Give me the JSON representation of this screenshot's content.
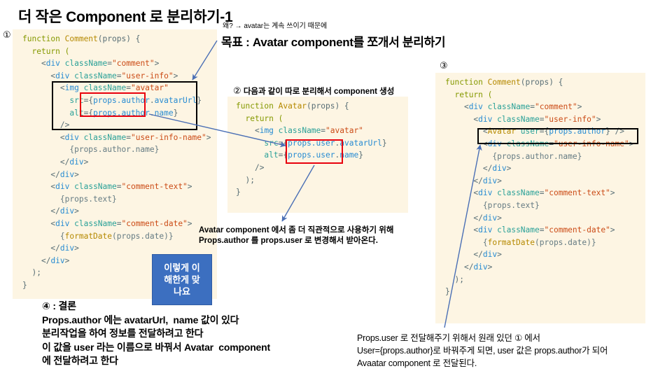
{
  "slide": {
    "title": "더 작은 Component 로 분리하기-1"
  },
  "markers": {
    "one": "①",
    "two": "②",
    "three": "③",
    "four": "④"
  },
  "notes": {
    "why": "왜? → avatar는 계속 쓰이기 때문에",
    "goal": "목표 : Avatar component를 쪼개서 분리하기",
    "step2_caption_num": "②",
    "step2_caption_text": "  다음과 같이 따로 분리해서 component 생성",
    "mid_note": "Avatar component 에서 좀 더 직관적으로 사용하기 위해\nProps.author 를 props.user 로 변경해서 받아온다.",
    "conclusion": "④ : 결론\nProps.author 에는 avatarUrl,  name 값이 있다\n분리작업을 하여 정보를 전달하려고 한다\n이 값을 user 라는 이름으로 바꿔서 Avatar  component\n에 전달하려고 한다",
    "bottom_right": "Props.user 로 전달해주기 위해서 원래 있던 ① 에서\nUser={props.author}로 바꿔주게 되면, user 값은 props.author가 되어\nAvaatar component 로 전달된다."
  },
  "callout": {
    "blue_text": "이렇게 이\n해한게 맞\n나요"
  },
  "code_blocks": {
    "block1": [
      {
        "indent": 0,
        "parts": [
          {
            "t": "function ",
            "c": "tok-kw"
          },
          {
            "t": "Comment",
            "c": "tok-fn"
          },
          {
            "t": "(props) {",
            "c": "tok-brk"
          }
        ]
      },
      {
        "indent": 1,
        "parts": [
          {
            "t": "return (",
            "c": "tok-kw"
          }
        ]
      },
      {
        "indent": 2,
        "parts": [
          {
            "t": "<",
            "c": "tok-brk"
          },
          {
            "t": "div ",
            "c": "tok-tag"
          },
          {
            "t": "className",
            "c": "tok-attr"
          },
          {
            "t": "=",
            "c": "tok-brk"
          },
          {
            "t": "\"comment\"",
            "c": "tok-str"
          },
          {
            "t": ">",
            "c": "tok-brk"
          }
        ]
      },
      {
        "indent": 3,
        "parts": [
          {
            "t": "<",
            "c": "tok-brk"
          },
          {
            "t": "div ",
            "c": "tok-tag"
          },
          {
            "t": "className",
            "c": "tok-attr"
          },
          {
            "t": "=",
            "c": "tok-brk"
          },
          {
            "t": "\"user-info\"",
            "c": "tok-str"
          },
          {
            "t": ">",
            "c": "tok-brk"
          }
        ]
      },
      {
        "indent": 4,
        "parts": [
          {
            "t": "<",
            "c": "tok-brk"
          },
          {
            "t": "img ",
            "c": "tok-tag"
          },
          {
            "t": "className",
            "c": "tok-attr"
          },
          {
            "t": "=",
            "c": "tok-brk"
          },
          {
            "t": "\"avatar\"",
            "c": "tok-str"
          }
        ]
      },
      {
        "indent": 5,
        "parts": [
          {
            "t": "src",
            "c": "tok-attr"
          },
          {
            "t": "={",
            "c": "tok-brk"
          },
          {
            "t": "props.author",
            "c": "tok-expr"
          },
          {
            "t": ".",
            "c": "tok-brk"
          },
          {
            "t": "avatarUrl",
            "c": "tok-expr"
          },
          {
            "t": "}",
            "c": "tok-brk"
          }
        ]
      },
      {
        "indent": 5,
        "parts": [
          {
            "t": "alt",
            "c": "tok-attr"
          },
          {
            "t": "={",
            "c": "tok-brk"
          },
          {
            "t": "props.author",
            "c": "tok-expr"
          },
          {
            "t": ".",
            "c": "tok-brk"
          },
          {
            "t": "name",
            "c": "tok-expr"
          },
          {
            "t": "}",
            "c": "tok-brk"
          }
        ]
      },
      {
        "indent": 4,
        "parts": [
          {
            "t": "/>",
            "c": "tok-brk"
          }
        ]
      },
      {
        "indent": 4,
        "parts": [
          {
            "t": "<",
            "c": "tok-brk"
          },
          {
            "t": "div ",
            "c": "tok-tag"
          },
          {
            "t": "className",
            "c": "tok-attr"
          },
          {
            "t": "=",
            "c": "tok-brk"
          },
          {
            "t": "\"user-info-name\"",
            "c": "tok-str"
          },
          {
            "t": ">",
            "c": "tok-brk"
          }
        ]
      },
      {
        "indent": 5,
        "parts": [
          {
            "t": "{props.author.name}",
            "c": "tok-pl"
          }
        ]
      },
      {
        "indent": 4,
        "parts": [
          {
            "t": "</",
            "c": "tok-brk"
          },
          {
            "t": "div",
            "c": "tok-tag"
          },
          {
            "t": ">",
            "c": "tok-brk"
          }
        ]
      },
      {
        "indent": 3,
        "parts": [
          {
            "t": "</",
            "c": "tok-brk"
          },
          {
            "t": "div",
            "c": "tok-tag"
          },
          {
            "t": ">",
            "c": "tok-brk"
          }
        ]
      },
      {
        "indent": 3,
        "parts": [
          {
            "t": "<",
            "c": "tok-brk"
          },
          {
            "t": "div ",
            "c": "tok-tag"
          },
          {
            "t": "className",
            "c": "tok-attr"
          },
          {
            "t": "=",
            "c": "tok-brk"
          },
          {
            "t": "\"comment-text\"",
            "c": "tok-str"
          },
          {
            "t": ">",
            "c": "tok-brk"
          }
        ]
      },
      {
        "indent": 4,
        "parts": [
          {
            "t": "{props.text}",
            "c": "tok-pl"
          }
        ]
      },
      {
        "indent": 3,
        "parts": [
          {
            "t": "</",
            "c": "tok-brk"
          },
          {
            "t": "div",
            "c": "tok-tag"
          },
          {
            "t": ">",
            "c": "tok-brk"
          }
        ]
      },
      {
        "indent": 3,
        "parts": [
          {
            "t": "<",
            "c": "tok-brk"
          },
          {
            "t": "div ",
            "c": "tok-tag"
          },
          {
            "t": "className",
            "c": "tok-attr"
          },
          {
            "t": "=",
            "c": "tok-brk"
          },
          {
            "t": "\"comment-date\"",
            "c": "tok-str"
          },
          {
            "t": ">",
            "c": "tok-brk"
          }
        ]
      },
      {
        "indent": 4,
        "parts": [
          {
            "t": "{",
            "c": "tok-pl"
          },
          {
            "t": "formatDate",
            "c": "tok-fn"
          },
          {
            "t": "(props.date)}",
            "c": "tok-pl"
          }
        ]
      },
      {
        "indent": 3,
        "parts": [
          {
            "t": "</",
            "c": "tok-brk"
          },
          {
            "t": "div",
            "c": "tok-tag"
          },
          {
            "t": ">",
            "c": "tok-brk"
          }
        ]
      },
      {
        "indent": 2,
        "parts": [
          {
            "t": "</",
            "c": "tok-brk"
          },
          {
            "t": "div",
            "c": "tok-tag"
          },
          {
            "t": ">",
            "c": "tok-brk"
          }
        ]
      },
      {
        "indent": 1,
        "parts": [
          {
            "t": ");",
            "c": "tok-brk"
          }
        ]
      },
      {
        "indent": 0,
        "parts": [
          {
            "t": "}",
            "c": "tok-brk"
          }
        ]
      }
    ],
    "block2": [
      {
        "indent": 0,
        "parts": [
          {
            "t": "function ",
            "c": "tok-kw"
          },
          {
            "t": "Avatar",
            "c": "tok-fn"
          },
          {
            "t": "(props) {",
            "c": "tok-brk"
          }
        ]
      },
      {
        "indent": 1,
        "parts": [
          {
            "t": "return (",
            "c": "tok-kw"
          }
        ]
      },
      {
        "indent": 2,
        "parts": [
          {
            "t": "<",
            "c": "tok-brk"
          },
          {
            "t": "img ",
            "c": "tok-tag"
          },
          {
            "t": "className",
            "c": "tok-attr"
          },
          {
            "t": "=",
            "c": "tok-brk"
          },
          {
            "t": "\"avatar\"",
            "c": "tok-str"
          }
        ]
      },
      {
        "indent": 3,
        "parts": [
          {
            "t": "src",
            "c": "tok-attr"
          },
          {
            "t": "={",
            "c": "tok-brk"
          },
          {
            "t": "props.user",
            "c": "tok-expr"
          },
          {
            "t": ".",
            "c": "tok-brk"
          },
          {
            "t": "avatarUrl",
            "c": "tok-expr"
          },
          {
            "t": "}",
            "c": "tok-brk"
          }
        ]
      },
      {
        "indent": 3,
        "parts": [
          {
            "t": "alt",
            "c": "tok-attr"
          },
          {
            "t": "={",
            "c": "tok-brk"
          },
          {
            "t": "props.user",
            "c": "tok-expr"
          },
          {
            "t": ".",
            "c": "tok-brk"
          },
          {
            "t": "name",
            "c": "tok-expr"
          },
          {
            "t": "}",
            "c": "tok-brk"
          }
        ]
      },
      {
        "indent": 2,
        "parts": [
          {
            "t": "/>",
            "c": "tok-brk"
          }
        ]
      },
      {
        "indent": 1,
        "parts": [
          {
            "t": ");",
            "c": "tok-brk"
          }
        ]
      },
      {
        "indent": 0,
        "parts": [
          {
            "t": "}",
            "c": "tok-brk"
          }
        ]
      }
    ],
    "block3": [
      {
        "indent": 0,
        "parts": [
          {
            "t": "function ",
            "c": "tok-kw"
          },
          {
            "t": "Comment",
            "c": "tok-fn"
          },
          {
            "t": "(props) {",
            "c": "tok-brk"
          }
        ]
      },
      {
        "indent": 1,
        "parts": [
          {
            "t": "return (",
            "c": "tok-kw"
          }
        ]
      },
      {
        "indent": 2,
        "parts": [
          {
            "t": "<",
            "c": "tok-brk"
          },
          {
            "t": "div ",
            "c": "tok-tag"
          },
          {
            "t": "className",
            "c": "tok-attr"
          },
          {
            "t": "=",
            "c": "tok-brk"
          },
          {
            "t": "\"comment\"",
            "c": "tok-str"
          },
          {
            "t": ">",
            "c": "tok-brk"
          }
        ]
      },
      {
        "indent": 3,
        "parts": [
          {
            "t": "<",
            "c": "tok-brk"
          },
          {
            "t": "div ",
            "c": "tok-tag"
          },
          {
            "t": "className",
            "c": "tok-attr"
          },
          {
            "t": "=",
            "c": "tok-brk"
          },
          {
            "t": "\"user-info\"",
            "c": "tok-str"
          },
          {
            "t": ">",
            "c": "tok-brk"
          }
        ]
      },
      {
        "indent": 4,
        "parts": [
          {
            "t": "<",
            "c": "tok-brk"
          },
          {
            "t": "Avatar ",
            "c": "tok-fn"
          },
          {
            "t": "user",
            "c": "tok-attr"
          },
          {
            "t": "={",
            "c": "tok-brk"
          },
          {
            "t": "props.author",
            "c": "tok-expr"
          },
          {
            "t": "} />",
            "c": "tok-brk"
          }
        ]
      },
      {
        "indent": 4,
        "parts": [
          {
            "t": "<",
            "c": "tok-brk"
          },
          {
            "t": "div ",
            "c": "tok-tag"
          },
          {
            "t": "className",
            "c": "tok-attr"
          },
          {
            "t": "=",
            "c": "tok-brk"
          },
          {
            "t": "\"user-info-name\"",
            "c": "tok-str"
          },
          {
            "t": ">",
            "c": "tok-brk"
          }
        ]
      },
      {
        "indent": 5,
        "parts": [
          {
            "t": "{props.author.name}",
            "c": "tok-pl"
          }
        ]
      },
      {
        "indent": 4,
        "parts": [
          {
            "t": "</",
            "c": "tok-brk"
          },
          {
            "t": "div",
            "c": "tok-tag"
          },
          {
            "t": ">",
            "c": "tok-brk"
          }
        ]
      },
      {
        "indent": 3,
        "parts": [
          {
            "t": "</",
            "c": "tok-brk"
          },
          {
            "t": "div",
            "c": "tok-tag"
          },
          {
            "t": ">",
            "c": "tok-brk"
          }
        ]
      },
      {
        "indent": 3,
        "parts": [
          {
            "t": "<",
            "c": "tok-brk"
          },
          {
            "t": "div ",
            "c": "tok-tag"
          },
          {
            "t": "className",
            "c": "tok-attr"
          },
          {
            "t": "=",
            "c": "tok-brk"
          },
          {
            "t": "\"comment-text\"",
            "c": "tok-str"
          },
          {
            "t": ">",
            "c": "tok-brk"
          }
        ]
      },
      {
        "indent": 4,
        "parts": [
          {
            "t": "{props.text}",
            "c": "tok-pl"
          }
        ]
      },
      {
        "indent": 3,
        "parts": [
          {
            "t": "</",
            "c": "tok-brk"
          },
          {
            "t": "div",
            "c": "tok-tag"
          },
          {
            "t": ">",
            "c": "tok-brk"
          }
        ]
      },
      {
        "indent": 3,
        "parts": [
          {
            "t": "<",
            "c": "tok-brk"
          },
          {
            "t": "div ",
            "c": "tok-tag"
          },
          {
            "t": "className",
            "c": "tok-attr"
          },
          {
            "t": "=",
            "c": "tok-brk"
          },
          {
            "t": "\"comment-date\"",
            "c": "tok-str"
          },
          {
            "t": ">",
            "c": "tok-brk"
          }
        ]
      },
      {
        "indent": 4,
        "parts": [
          {
            "t": "{",
            "c": "tok-pl"
          },
          {
            "t": "formatDate",
            "c": "tok-fn"
          },
          {
            "t": "(props.date)}",
            "c": "tok-pl"
          }
        ]
      },
      {
        "indent": 3,
        "parts": [
          {
            "t": "</",
            "c": "tok-brk"
          },
          {
            "t": "div",
            "c": "tok-tag"
          },
          {
            "t": ">",
            "c": "tok-brk"
          }
        ]
      },
      {
        "indent": 2,
        "parts": [
          {
            "t": "</",
            "c": "tok-brk"
          },
          {
            "t": "div",
            "c": "tok-tag"
          },
          {
            "t": ">",
            "c": "tok-brk"
          }
        ]
      },
      {
        "indent": 1,
        "parts": [
          {
            "t": ");",
            "c": "tok-brk"
          }
        ]
      },
      {
        "indent": 0,
        "parts": [
          {
            "t": "}",
            "c": "tok-brk"
          }
        ]
      }
    ]
  },
  "colors": {
    "code_background": "#fdf5e3",
    "highlight_black": "#000000",
    "highlight_red": "#e8000d",
    "arrow_blue": "#4a6fb5",
    "callout_blue": "#3c6fc0"
  }
}
